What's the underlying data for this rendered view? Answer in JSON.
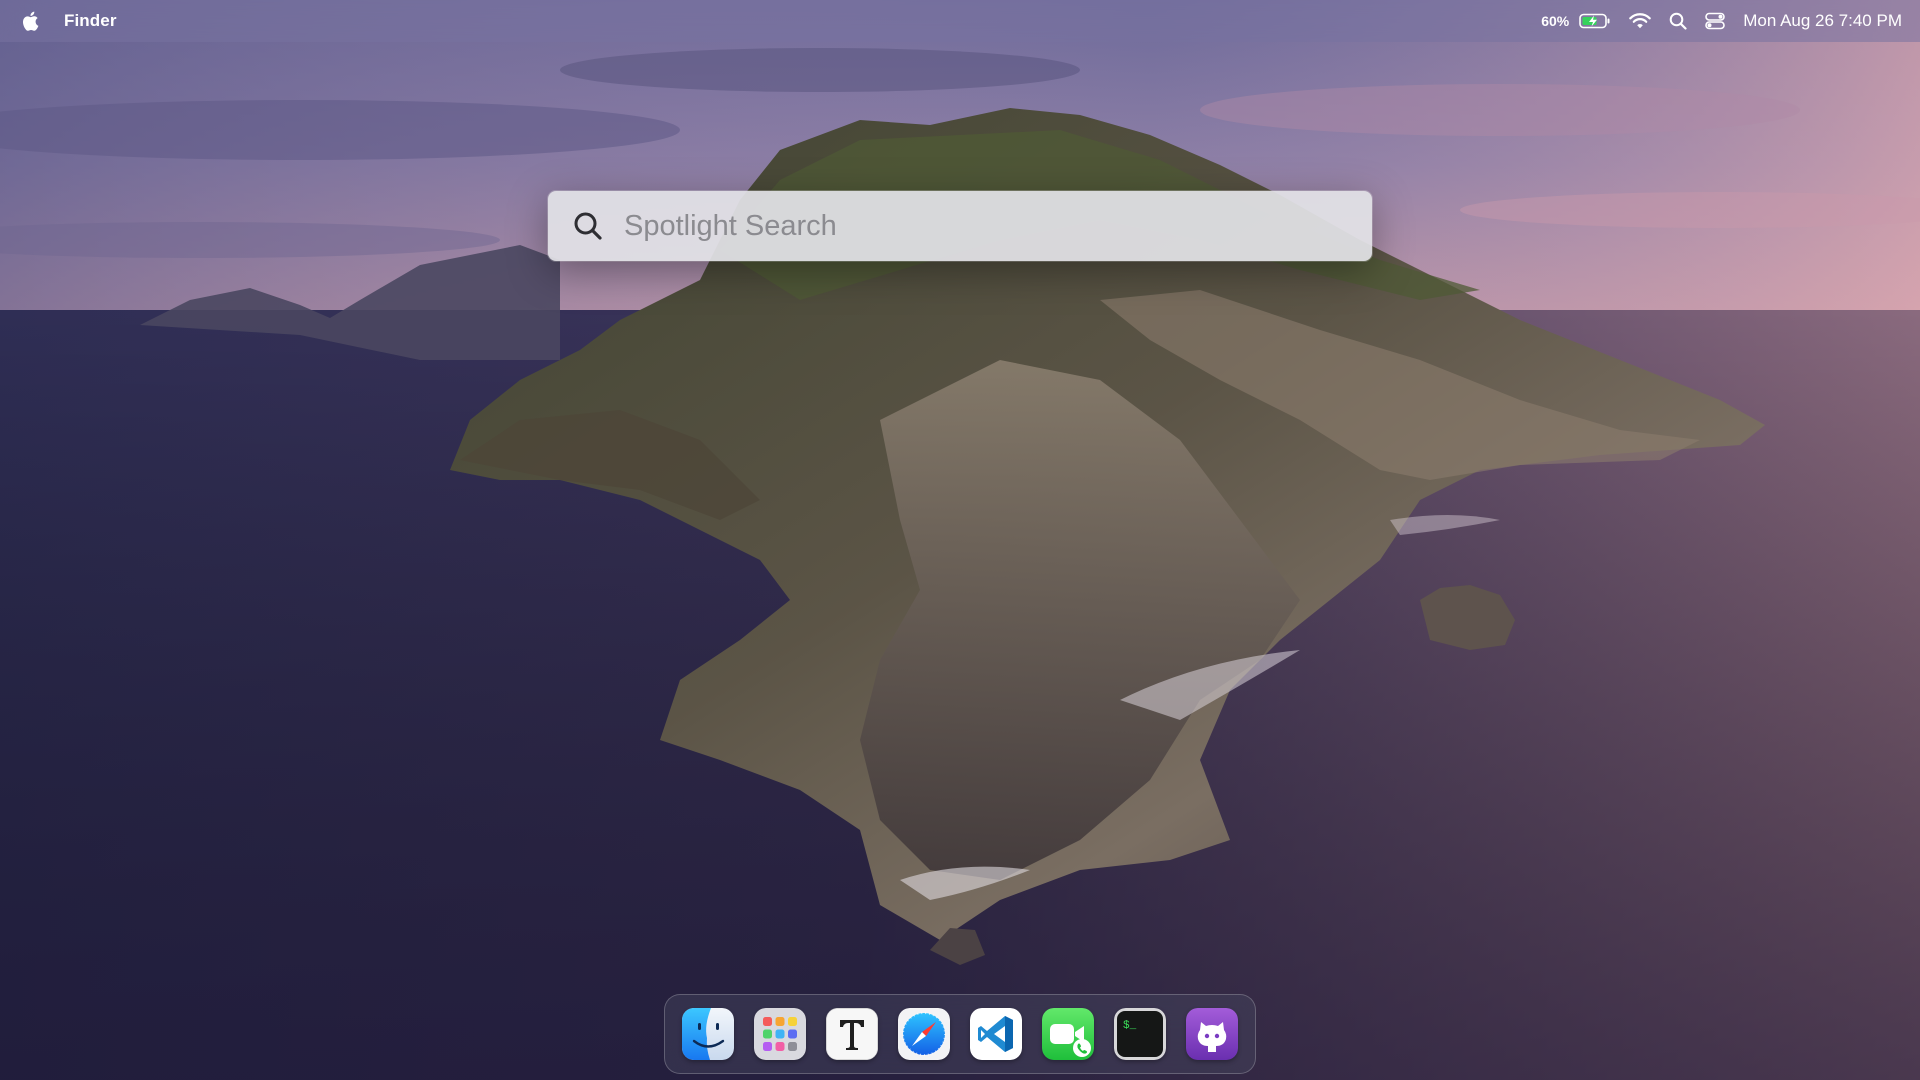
{
  "menubar": {
    "app_name": "Finder",
    "battery_percent": "60%",
    "clock": "Mon Aug 26 7:40 PM",
    "icons": [
      "apple-icon",
      "battery-charging-icon",
      "wifi-icon",
      "search-icon",
      "control-center-icon"
    ]
  },
  "spotlight": {
    "placeholder": "Spotlight Search",
    "value": ""
  },
  "dock": {
    "items": [
      {
        "name": "Finder",
        "icon": "finder-icon"
      },
      {
        "name": "Launchpad",
        "icon": "launchpad-icon"
      },
      {
        "name": "Typora",
        "icon": "typora-icon"
      },
      {
        "name": "Safari",
        "icon": "safari-icon"
      },
      {
        "name": "Visual Studio Code",
        "icon": "vscode-icon"
      },
      {
        "name": "FaceTime",
        "icon": "facetime-icon"
      },
      {
        "name": "Terminal",
        "icon": "terminal-icon"
      },
      {
        "name": "GitHub Desktop",
        "icon": "github-icon"
      }
    ]
  },
  "colors": {
    "menubar_bg": "#7873a0",
    "spotlight_bg": "#e2e2e6",
    "dock_bg": "#46465f"
  }
}
